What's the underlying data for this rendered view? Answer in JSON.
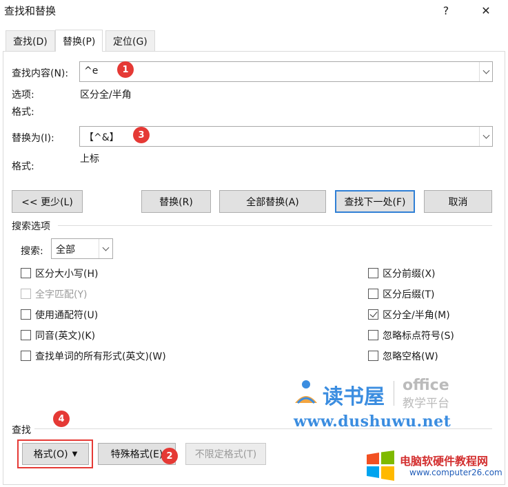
{
  "window": {
    "title": "查找和替换",
    "help_glyph": "?",
    "close_glyph": "✕"
  },
  "tabs": [
    {
      "label": "查找(D)",
      "active": false
    },
    {
      "label": "替换(P)",
      "active": true
    },
    {
      "label": "定位(G)",
      "active": false
    }
  ],
  "find": {
    "label": "查找内容(N):",
    "value": "^e",
    "options_label": "选项:",
    "options_value": "区分全/半角",
    "format_label": "格式:"
  },
  "replace": {
    "label": "替换为(I):",
    "value": "【^&】",
    "format_label": "格式:",
    "format_value": "上标"
  },
  "buttons": {
    "less": "<< 更少(L)",
    "replace": "替换(R)",
    "replace_all": "全部替换(A)",
    "find_next": "查找下一处(F)",
    "cancel": "取消"
  },
  "search_options": {
    "section_title": "搜索选项",
    "search_label": "搜索:",
    "search_value": "全部",
    "left": [
      {
        "label": "区分大小写(H)",
        "checked": false,
        "disabled": false
      },
      {
        "label": "全字匹配(Y)",
        "checked": false,
        "disabled": true
      },
      {
        "label": "使用通配符(U)",
        "checked": false,
        "disabled": false
      },
      {
        "label": "同音(英文)(K)",
        "checked": false,
        "disabled": false
      },
      {
        "label": "查找单词的所有形式(英文)(W)",
        "checked": false,
        "disabled": false
      }
    ],
    "right": [
      {
        "label": "区分前缀(X)",
        "checked": false
      },
      {
        "label": "区分后缀(T)",
        "checked": false
      },
      {
        "label": "区分全/半角(M)",
        "checked": true
      },
      {
        "label": "忽略标点符号(S)",
        "checked": false
      },
      {
        "label": "忽略空格(W)",
        "checked": false
      }
    ]
  },
  "find_section": {
    "title": "查找",
    "format_button": "格式(O)",
    "special_button": "特殊格式(E)",
    "no_format_button": "不限定格式(T)"
  },
  "annotations": [
    "1",
    "2",
    "3",
    "4"
  ],
  "watermark": {
    "site_cn": "读书屋",
    "office_text": "office",
    "office_sub": "教学平台",
    "url": "www.dushuwu.net",
    "brand2": "电脑软硬件教程网",
    "url2": "www.computer26.com"
  }
}
